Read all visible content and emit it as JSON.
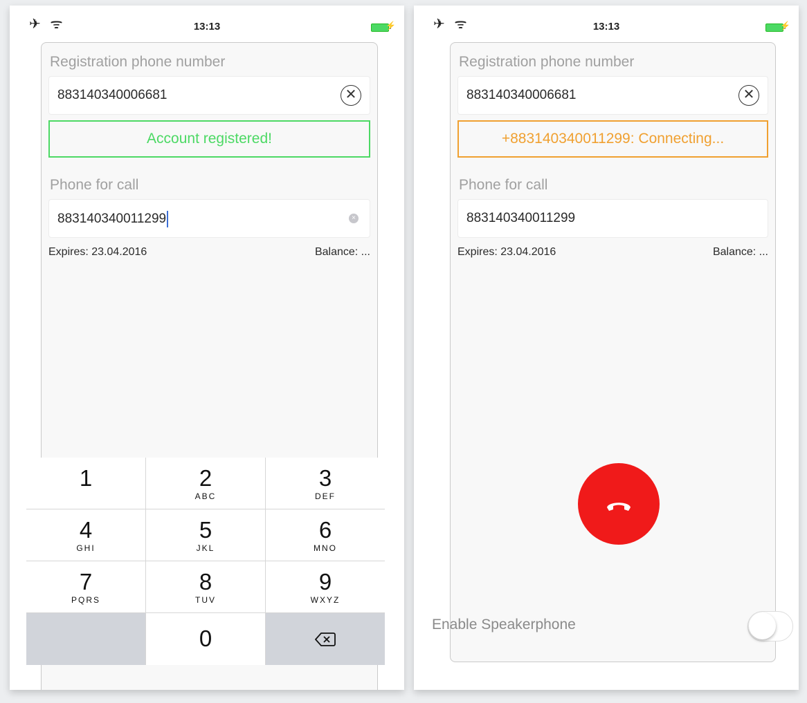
{
  "left": {
    "status_bar": {
      "time": "13:13",
      "icons": "✈ ᯤ",
      "charging": "⚡"
    },
    "registration_label": "Registration phone number",
    "registration_value": "883140340006681",
    "clear_icon": "⊗",
    "status_message": "Account registered!",
    "status_color": "#4cd964",
    "phone_label": "Phone for call",
    "phone_value": "883140340011299",
    "expires": "Expires: 23.04.2016",
    "balance": "Balance: ...",
    "keypad": [
      {
        "num": "1",
        "sub": ""
      },
      {
        "num": "2",
        "sub": "ABC"
      },
      {
        "num": "3",
        "sub": "DEF"
      },
      {
        "num": "4",
        "sub": "GHI"
      },
      {
        "num": "5",
        "sub": "JKL"
      },
      {
        "num": "6",
        "sub": "MNO"
      },
      {
        "num": "7",
        "sub": "PQRS"
      },
      {
        "num": "8",
        "sub": "TUV"
      },
      {
        "num": "9",
        "sub": "WXYZ"
      },
      {
        "num": "0",
        "sub": ""
      }
    ]
  },
  "right": {
    "status_bar": {
      "time": "13:13",
      "icons": "✈ ᯤ",
      "charging": "⚡"
    },
    "registration_label": "Registration phone number",
    "registration_value": "883140340006681",
    "clear_icon": "⊗",
    "status_message": "+883140340011299: Connecting...",
    "status_color": "#f0a030",
    "phone_label": "Phone for call",
    "phone_value": "883140340011299",
    "expires": "Expires: 23.04.2016",
    "balance": "Balance: ...",
    "end_call_color": "#f01a1a",
    "speaker_label": "Enable Speakerphone",
    "speaker_enabled": false
  }
}
